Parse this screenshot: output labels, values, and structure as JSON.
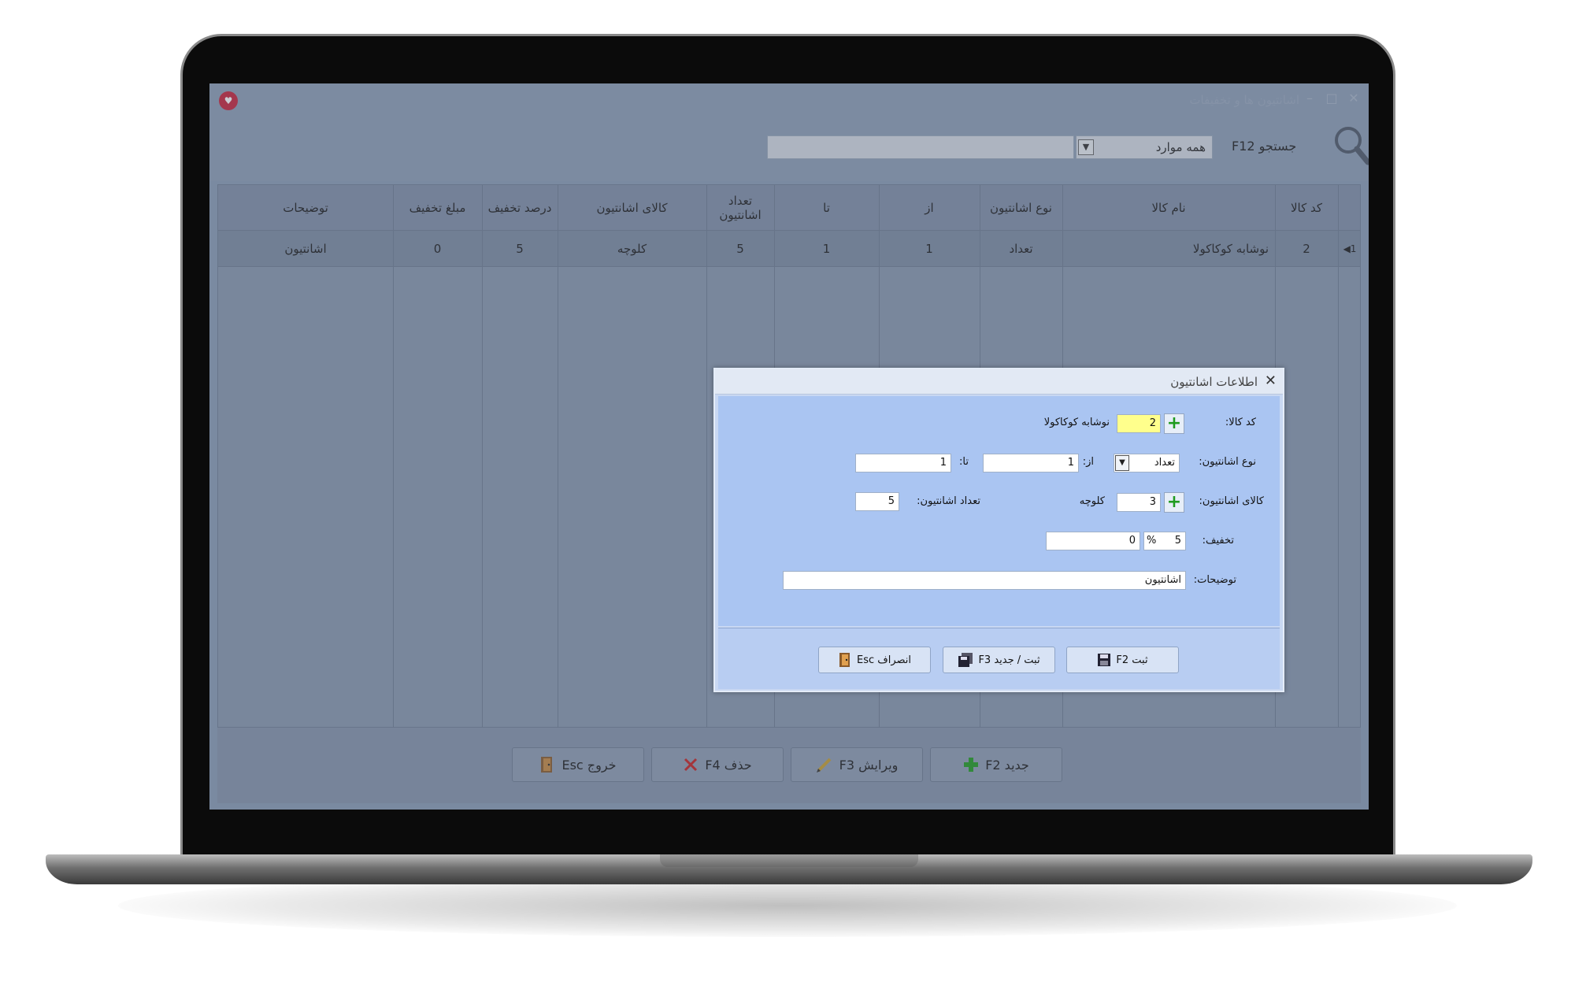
{
  "window": {
    "title": "اشانتیون ها و تخفیفات",
    "controls": {
      "minimize": "–",
      "maximize": "□",
      "close": "✕"
    }
  },
  "toolbar": {
    "search_label": "جستجو F12",
    "filter_value": "همه موارد",
    "search_value": ""
  },
  "grid": {
    "columns": [
      "کد کالا",
      "نام کالا",
      "نوع اشانتیون",
      "از",
      "تا",
      "تعداد اشانتیون",
      "کالای اشانتیون",
      "درصد تخفیف",
      "مبلغ تخفیف",
      "توضیحات"
    ],
    "rows": [
      {
        "indicator": "1",
        "code": "2",
        "name": "نوشابه کوکاکولا",
        "type": "تعداد",
        "from": "1",
        "to": "1",
        "count": "5",
        "gift_item": "کلوچه",
        "discount_percent": "5",
        "discount_amount": "0",
        "notes": "اشانتیون"
      }
    ]
  },
  "bottom_buttons": {
    "new": "جدید F2",
    "edit": "ویرایش F3",
    "delete": "حذف F4",
    "exit": "خروج Esc"
  },
  "dialog": {
    "title": "اطلاعات اشانتیون",
    "close": "✕",
    "fields": {
      "item_code_label": "کد کالا:",
      "item_code_value": "2",
      "item_name": "نوشابه کوکاکولا",
      "type_label": "نوع اشانتیون:",
      "type_value": "تعداد",
      "from_label": "از:",
      "from_value": "1",
      "to_label": "تا:",
      "to_value": "1",
      "gift_item_label": "کالای اشانتیون:",
      "gift_item_code": "3",
      "gift_item_name": "کلوچه",
      "gift_count_label": "تعداد اشانتیون:",
      "gift_count_value": "5",
      "discount_label": "تخفیف:",
      "discount_percent": "5",
      "percent_sign": "%",
      "discount_amount": "0",
      "notes_label": "توضیحات:",
      "notes_value": "اشانتیون"
    },
    "buttons": {
      "save": "ثبت F2",
      "save_new": "ثبت / جدید F3",
      "cancel": "انصراف Esc"
    }
  },
  "colors": {
    "dialog_body": "#aac5f2",
    "dialog_footer": "#b8cdf2",
    "highlight_field": "#ffff8c",
    "plus_green": "#1f9b1f",
    "app_logo": "#c8233a"
  }
}
